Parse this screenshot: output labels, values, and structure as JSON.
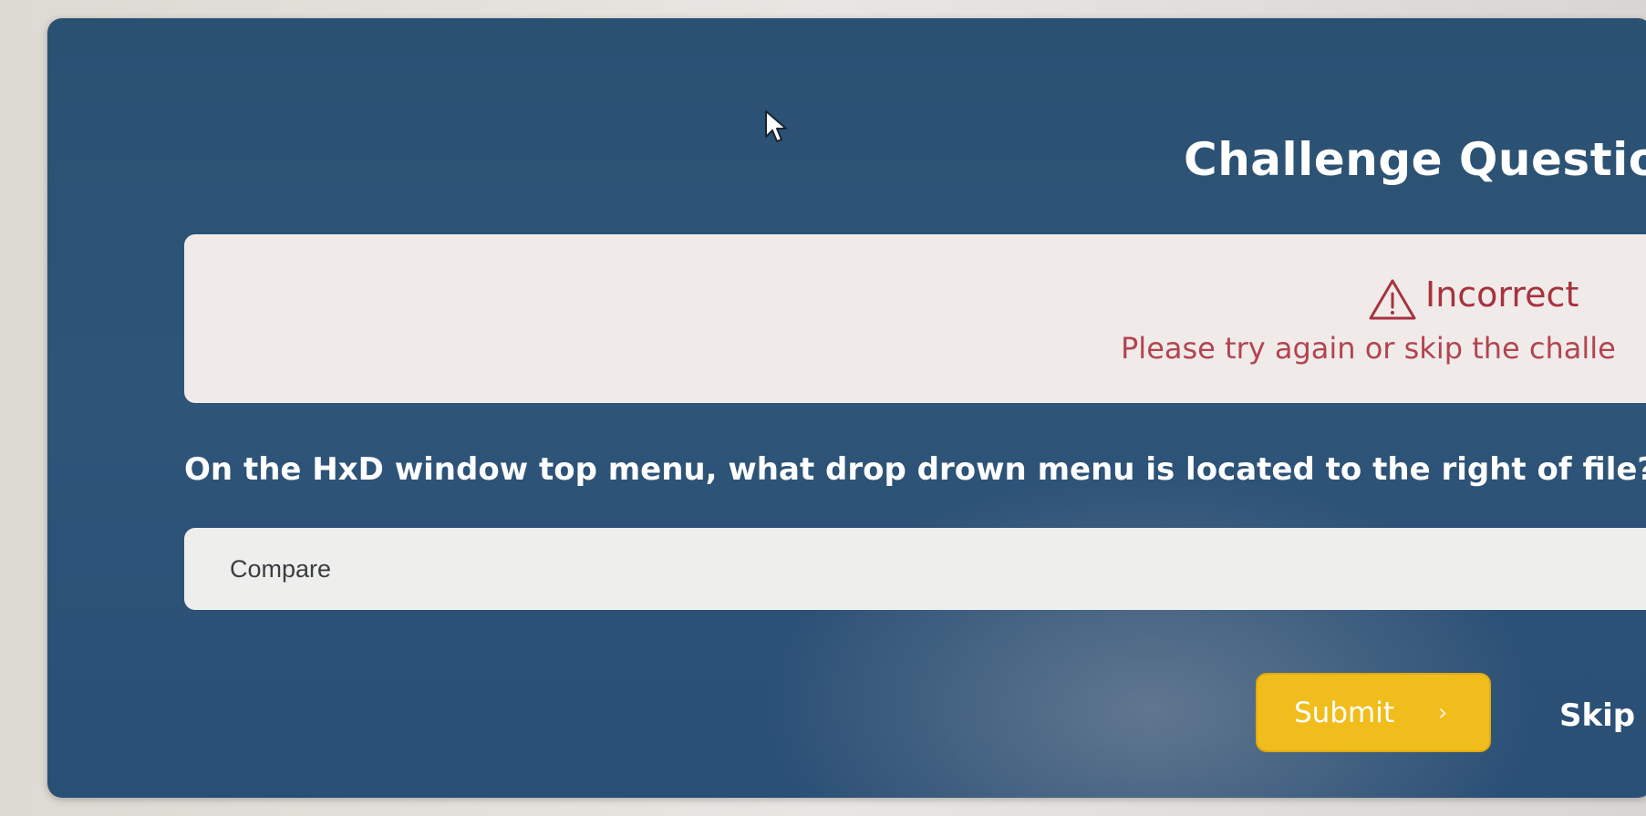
{
  "challenge": {
    "title": "Challenge Question #"
  },
  "feedback": {
    "icon": "warning-icon",
    "title": "Incorrect",
    "message": "Please try again or skip the challe",
    "color": "#a7323f"
  },
  "question": {
    "text": "On the HxD window top menu, what drop drown menu is located to the right of file?"
  },
  "answer": {
    "value": "Compare"
  },
  "actions": {
    "submit_label": "Submit",
    "submit_icon": "chevron-right-icon",
    "skip_label": "Skip",
    "accent": "#f0bd1c"
  },
  "theme": {
    "panel": "#2c5276",
    "alert_bg": "#f0ebe9"
  }
}
